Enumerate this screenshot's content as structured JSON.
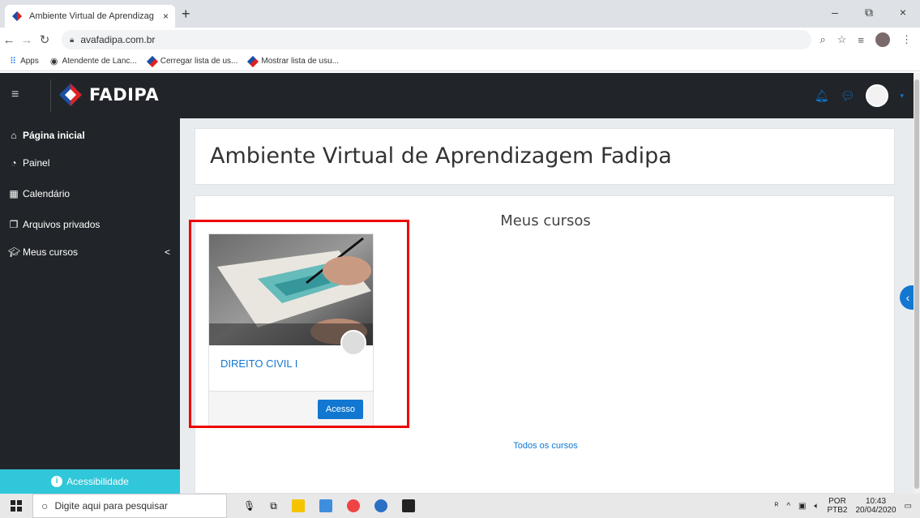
{
  "browser": {
    "tab_title": "Ambiente Virtual de Aprendizag",
    "tab_close": "×",
    "new_tab": "+",
    "window_controls": [
      "–",
      "⧉",
      "×"
    ],
    "url": "avafadipa.com.br",
    "bookmarks": [
      {
        "label": "Apps",
        "icon": "apps-grid-icon"
      },
      {
        "label": "Atendente de Lanc...",
        "icon": "globe-icon"
      },
      {
        "label": "Cerregar lista de us...",
        "icon": "fadipa-diamond-icon"
      },
      {
        "label": "Mostrar lista de usu...",
        "icon": "fadipa-diamond-icon"
      }
    ]
  },
  "header": {
    "logo_text": "FADIPA",
    "colors": {
      "bar": "#212529",
      "accent": "#1177d1"
    }
  },
  "sidebar": {
    "items": [
      {
        "label": "Página inicial",
        "icon": "home-icon",
        "bold": true
      },
      {
        "label": "Painel",
        "icon": "dashboard-icon"
      },
      {
        "label": "Calendário",
        "icon": "calendar-icon"
      },
      {
        "label": "Arquivos privados",
        "icon": "files-icon"
      },
      {
        "label": "Meus cursos",
        "icon": "graduation-cap-icon",
        "chevron": "<"
      }
    ],
    "accessibility_label": "Acessibilidade",
    "accessibility_color": "#2fc7d9"
  },
  "main": {
    "page_title": "Ambiente Virtual de Aprendizagem Fadipa",
    "courses_title": "Meus cursos",
    "course": {
      "name": "DIREITO CIVIL I",
      "button_label": "Acesso"
    },
    "all_courses_link": "Todos os cursos"
  },
  "taskbar": {
    "search_placeholder": "Digite aqui para pesquisar",
    "lang_top": "POR",
    "lang_bottom": "PTB2",
    "time": "10:43",
    "date": "20/04/2020"
  }
}
